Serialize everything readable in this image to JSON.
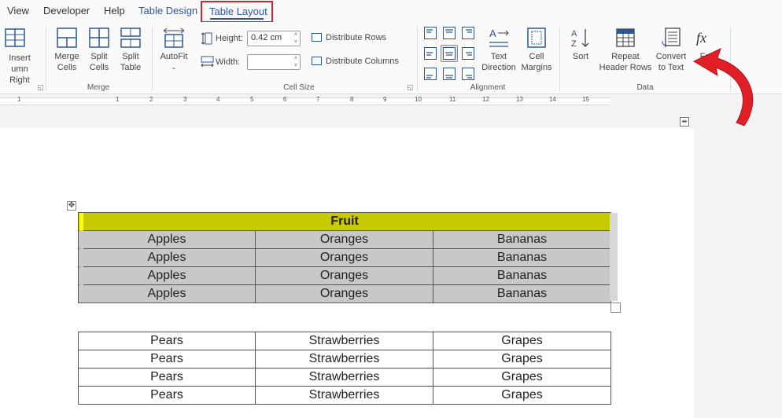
{
  "tabs": {
    "view": "View",
    "developer": "Developer",
    "help": "Help",
    "table_design": "Table Design",
    "table_layout": "Table Layout"
  },
  "ribbon": {
    "rows_cols": {
      "insert_col_line1": "Insert",
      "insert_col_line2": "umn Right"
    },
    "merge": {
      "label": "Merge",
      "merge_cells": [
        "Merge",
        "Cells"
      ],
      "split_cells": [
        "Split",
        "Cells"
      ],
      "split_table": [
        "Split",
        "Table"
      ]
    },
    "cell_size": {
      "label": "Cell Size",
      "autofit": "AutoFit",
      "height_label": "Height:",
      "height_value": "0.42 cm",
      "width_label": "Width:",
      "width_value": "",
      "distribute_rows": "Distribute Rows",
      "distribute_columns": "Distribute Columns"
    },
    "alignment": {
      "label": "Alignment",
      "text_direction": [
        "Text",
        "Direction"
      ],
      "cell_margins": [
        "Cell",
        "Margins"
      ]
    },
    "data": {
      "label": "Data",
      "sort": "Sort",
      "repeat_header": [
        "Repeat",
        "Header Rows"
      ],
      "convert": [
        "Convert",
        "to Text"
      ],
      "formula_partial": "Fo"
    }
  },
  "ruler": {
    "numbers": [
      "1",
      "1",
      "2",
      "3",
      "4",
      "5",
      "6",
      "7",
      "8",
      "9",
      "10",
      "11",
      "12",
      "13",
      "14",
      "15"
    ]
  },
  "table1": {
    "header": "Fruit",
    "rows": [
      [
        "Apples",
        "Oranges",
        "Bananas"
      ],
      [
        "Apples",
        "Oranges",
        "Bananas"
      ],
      [
        "Apples",
        "Oranges",
        "Bananas"
      ],
      [
        "Apples",
        "Oranges",
        "Bananas"
      ]
    ]
  },
  "table2": {
    "rows": [
      [
        "Pears",
        "Strawberries",
        "Grapes"
      ],
      [
        "Pears",
        "Strawberries",
        "Grapes"
      ],
      [
        "Pears",
        "Strawberries",
        "Grapes"
      ],
      [
        "Pears",
        "Strawberries",
        "Grapes"
      ]
    ]
  },
  "colors": {
    "accent": "#2b579a",
    "highlight_box": "#d1232a",
    "header_fill": "#c9c900",
    "selection": "#c8c8c8",
    "arrow": "#e01e26"
  }
}
